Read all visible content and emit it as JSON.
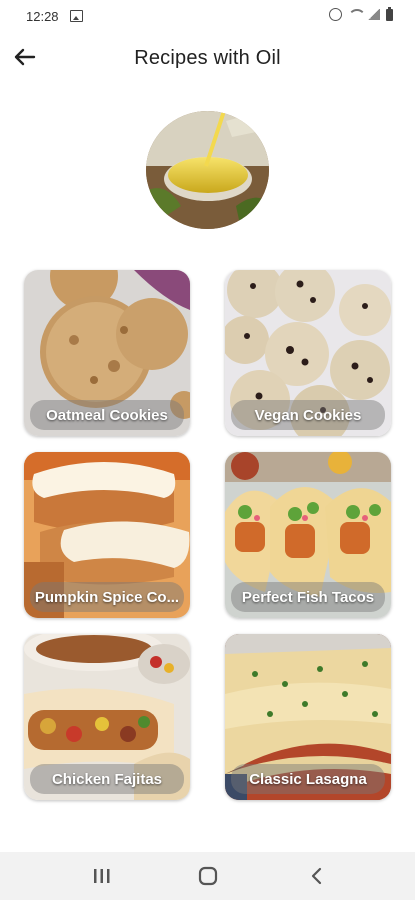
{
  "status_bar": {
    "time": "12:28"
  },
  "app_bar": {
    "title": "Recipes with Oil"
  },
  "recipes": [
    {
      "label": "Oatmeal Cookies"
    },
    {
      "label": "Vegan Cookies"
    },
    {
      "label": "Pumpkin Spice Co..."
    },
    {
      "label": "Perfect Fish Tacos"
    },
    {
      "label": "Chicken Fajitas"
    },
    {
      "label": "Classic Lasagna"
    }
  ]
}
